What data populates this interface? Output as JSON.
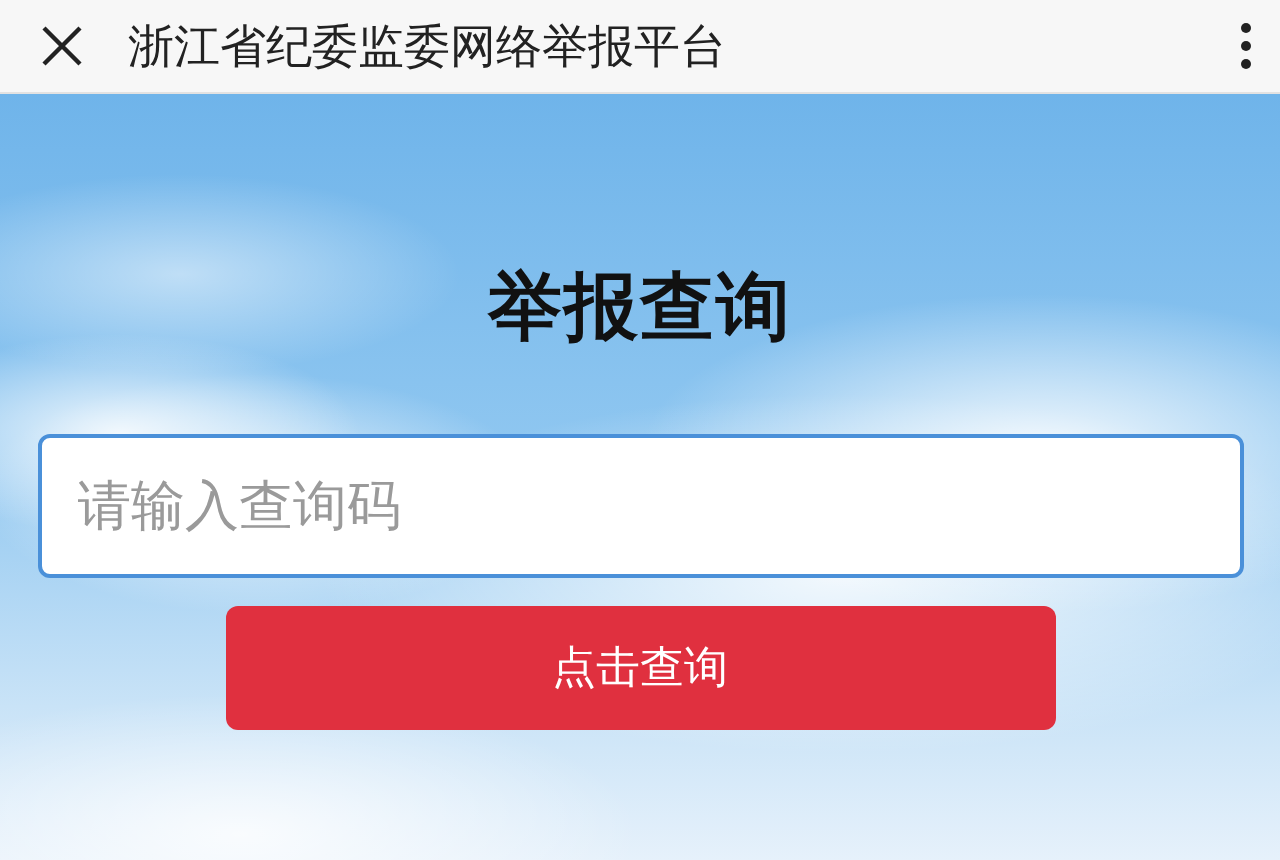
{
  "header": {
    "title": "浙江省纪委监委网络举报平台"
  },
  "page": {
    "heading": "举报查询"
  },
  "query_field": {
    "placeholder": "请输入查询码"
  },
  "submit_button": {
    "label": "点击查询"
  }
}
